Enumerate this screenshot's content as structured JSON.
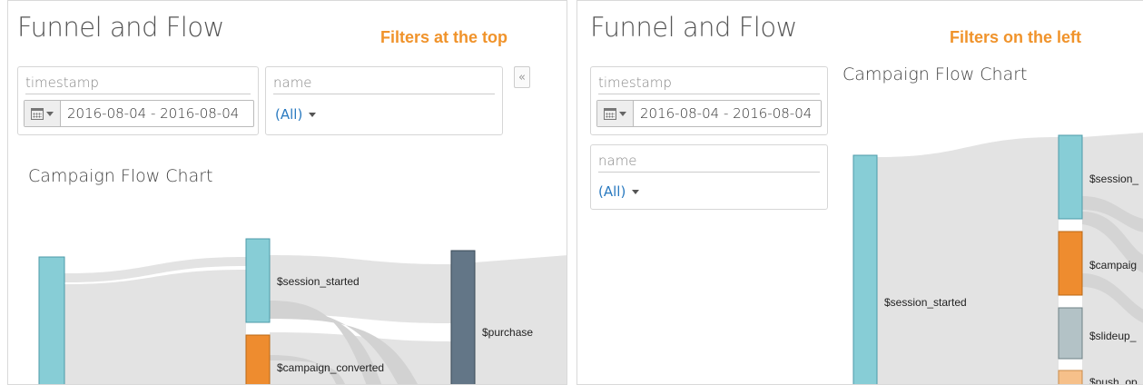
{
  "panels": [
    {
      "title": "Funnel and Flow",
      "callout": "Filters at the top",
      "filters": {
        "timestamp_label": "timestamp",
        "date_range": "2016-08-04 - 2016-08-04",
        "name_label": "name",
        "name_value": "(All)"
      },
      "collapse_glyph": "«",
      "chart_title": "Campaign Flow Chart",
      "nodes": [
        "$session_started",
        "$campaign_converted",
        "$purchase"
      ]
    },
    {
      "title": "Funnel and Flow",
      "callout": "Filters on the left",
      "filters": {
        "timestamp_label": "timestamp",
        "date_range": "2016-08-04 - 2016-08-04",
        "name_label": "name",
        "name_value": "(All)"
      },
      "chart_title": "Campaign Flow Chart",
      "nodes": [
        "$session_started",
        "$session_",
        "$campaig",
        "$slideup_",
        "$push_op"
      ]
    }
  ],
  "colors": {
    "teal": "#87cdd6",
    "orange": "#ee8c2f",
    "slate": "#637687",
    "gray_node": "#b3c2c6",
    "peach": "#f6c08a",
    "link": "#e3e3e3",
    "callout": "#f0932b"
  }
}
